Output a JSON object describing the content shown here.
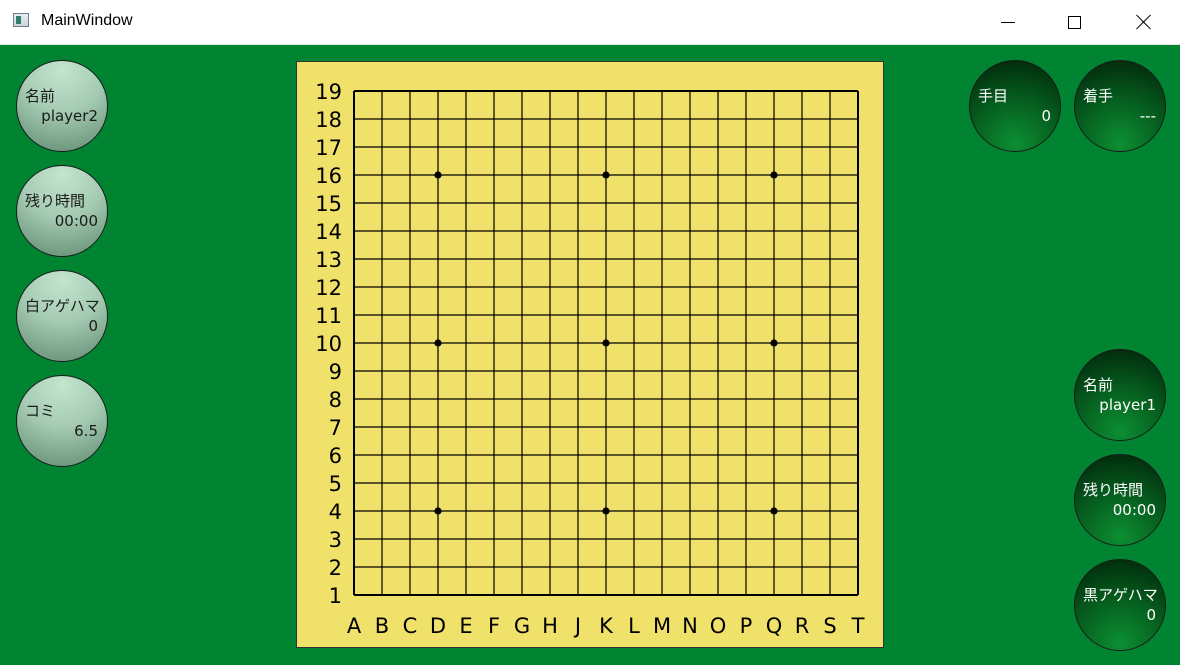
{
  "window": {
    "title": "MainWindow"
  },
  "left_panel": [
    {
      "label": "名前",
      "value": "player2"
    },
    {
      "label": "残り時間",
      "value": "00:00"
    },
    {
      "label": "白アゲハマ",
      "value": "0"
    },
    {
      "label": "コミ",
      "value": "6.5"
    }
  ],
  "right_top": [
    {
      "label": "手目",
      "value": "0"
    },
    {
      "label": "着手",
      "value": "---"
    }
  ],
  "right_bottom": [
    {
      "label": "名前",
      "value": "player1"
    },
    {
      "label": "残り時間",
      "value": "00:00"
    },
    {
      "label": "黒アゲハマ",
      "value": "0"
    }
  ],
  "board": {
    "size": 19,
    "column_labels": [
      "A",
      "B",
      "C",
      "D",
      "E",
      "F",
      "G",
      "H",
      "J",
      "K",
      "L",
      "M",
      "N",
      "O",
      "P",
      "Q",
      "R",
      "S",
      "T"
    ],
    "row_labels": [
      "19",
      "18",
      "17",
      "16",
      "15",
      "14",
      "13",
      "12",
      "11",
      "10",
      "9",
      "8",
      "7",
      "6",
      "5",
      "4",
      "3",
      "2",
      "1"
    ],
    "star_points": [
      "D16",
      "K16",
      "Q16",
      "D10",
      "K10",
      "Q10",
      "D4",
      "K4",
      "Q4"
    ]
  },
  "colors": {
    "background": "#008431",
    "board": "#f0e16a",
    "grid": "#000000"
  },
  "icons": [
    "app-icon",
    "minimize-icon",
    "maximize-icon",
    "close-icon"
  ]
}
